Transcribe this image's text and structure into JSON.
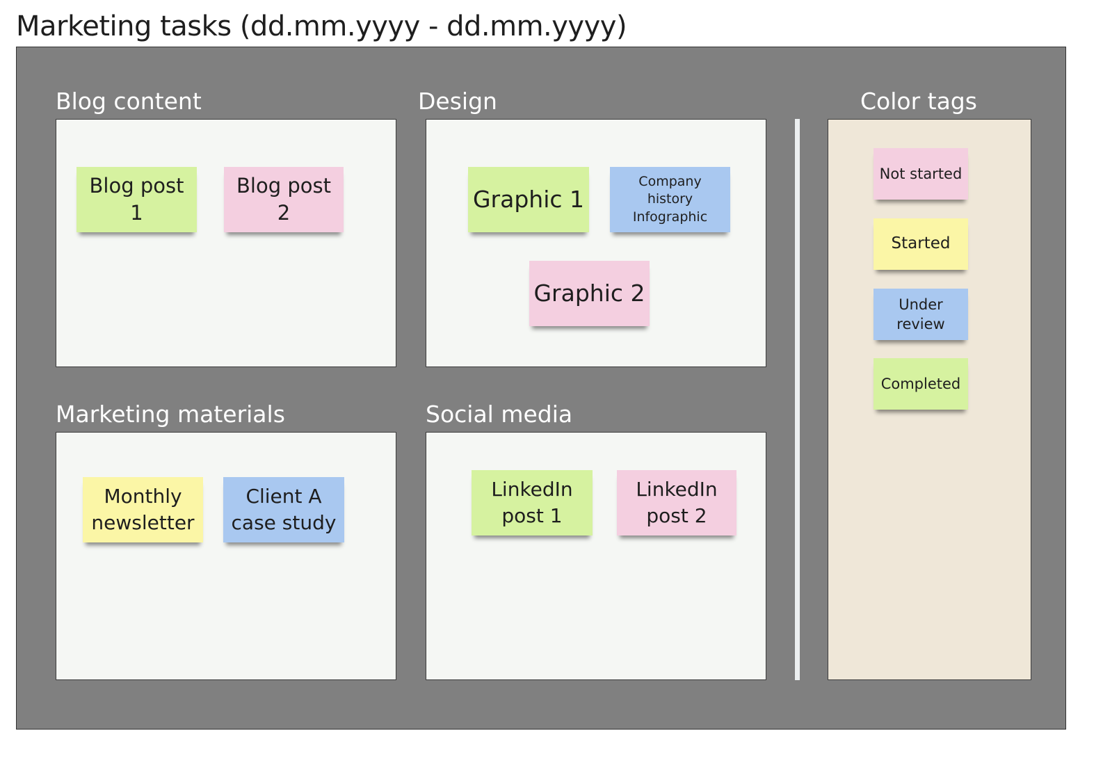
{
  "title": "Marketing tasks (dd.mm.yyyy - dd.mm.yyyy)",
  "sections": {
    "blog": {
      "label": "Blog content",
      "notes": [
        "Blog post 1",
        "Blog post 2"
      ]
    },
    "design": {
      "label": "Design",
      "notes": [
        "Graphic 1",
        "Company history Infographic",
        "Graphic 2"
      ]
    },
    "marketing": {
      "label": "Marketing materials",
      "notes": [
        "Monthly newsletter",
        "Client A case study"
      ]
    },
    "social": {
      "label": "Social media",
      "notes": [
        "LinkedIn post 1",
        "LinkedIn post 2"
      ]
    },
    "tags": {
      "label": "Color tags",
      "notes": [
        "Not started",
        "Started",
        "Under review",
        "Completed"
      ]
    }
  },
  "colors": {
    "board": "#808080",
    "frame": "#f5f7f4",
    "tags_frame": "#efe7d8",
    "not_started": "#f4cfe0",
    "started": "#fbf6a6",
    "under_review": "#a9c8f0",
    "completed": "#d6f2a0"
  }
}
